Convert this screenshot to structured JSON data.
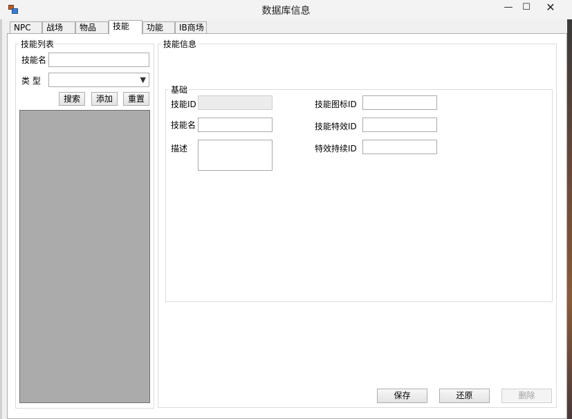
{
  "window": {
    "title": "数据库信息",
    "minimize_glyph": "—",
    "maximize_glyph": "☐",
    "close_glyph": "✕"
  },
  "tabs": [
    {
      "label": "NPC",
      "selected": false
    },
    {
      "label": "战场",
      "selected": false
    },
    {
      "label": "物品",
      "selected": false
    },
    {
      "label": "技能",
      "selected": true
    },
    {
      "label": "功能",
      "selected": false
    },
    {
      "label": "IB商场",
      "selected": false
    }
  ],
  "skill_list": {
    "group_title": "技能列表",
    "name_label": "技能名",
    "name_value": "",
    "type_label": "类 型",
    "type_selected": "",
    "search_label": "搜索",
    "add_label": "添加",
    "reset_label": "重置"
  },
  "skill_info": {
    "group_title": "技能信息",
    "basic_title": "基础",
    "skill_id_label": "技能ID",
    "skill_id_value": "",
    "skill_name_label": "技能名",
    "skill_name_value": "",
    "description_label": "描述",
    "description_value": "",
    "icon_id_label": "技能图标ID",
    "icon_id_value": "",
    "effect_id_label": "技能特效ID",
    "effect_id_value": "",
    "effect_duration_id_label": "特效持续ID",
    "effect_duration_id_value": ""
  },
  "actions": {
    "save_label": "保存",
    "restore_label": "还原",
    "delete_label": "删除"
  }
}
